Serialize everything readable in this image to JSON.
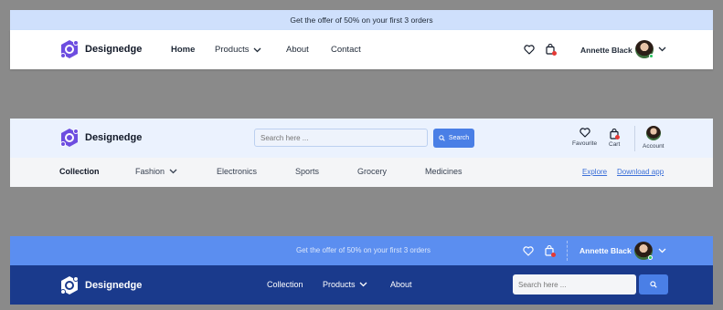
{
  "header1": {
    "offer_text": "Get the offer of 50% on your first 3 orders",
    "brand": "Designedge",
    "nav": [
      {
        "label": "Home",
        "active": true
      },
      {
        "label": "Products",
        "dropdown": true
      },
      {
        "label": "About"
      },
      {
        "label": "Contact"
      }
    ],
    "user_name": "Annette Black"
  },
  "header2": {
    "brand": "Designedge",
    "search_placeholder": "Search here ...",
    "search_button": "Search",
    "favourite_label": "Favourite",
    "cart_label": "Cart",
    "account_label": "Account",
    "categories": [
      {
        "label": "Collection",
        "active": true
      },
      {
        "label": "Fashion",
        "dropdown": true
      },
      {
        "label": "Electronics"
      },
      {
        "label": "Sports"
      },
      {
        "label": "Grocery"
      },
      {
        "label": "Medicines"
      }
    ],
    "explore_link": "Explore",
    "download_link": "Download app"
  },
  "header3": {
    "offer_text": "Get the offer of 50% on your first 3 orders",
    "user_name": "Annette Black",
    "brand": "Designedge",
    "nav": [
      {
        "label": "Collection"
      },
      {
        "label": "Products",
        "dropdown": true
      },
      {
        "label": "About"
      }
    ],
    "search_placeholder": "Search here ..."
  },
  "colors": {
    "offer_bg": "#cfe0fc",
    "brand_purple": "#6d4de0",
    "accent_blue": "#4a7fe6",
    "header3_top": "#5b8ef0",
    "header3_bottom": "#1a3a8c",
    "badge_red": "#e53935",
    "online_green": "#22c55e"
  },
  "icons": [
    "logo-icon",
    "heart-icon",
    "bag-icon",
    "chevron-down-icon",
    "search-icon"
  ]
}
